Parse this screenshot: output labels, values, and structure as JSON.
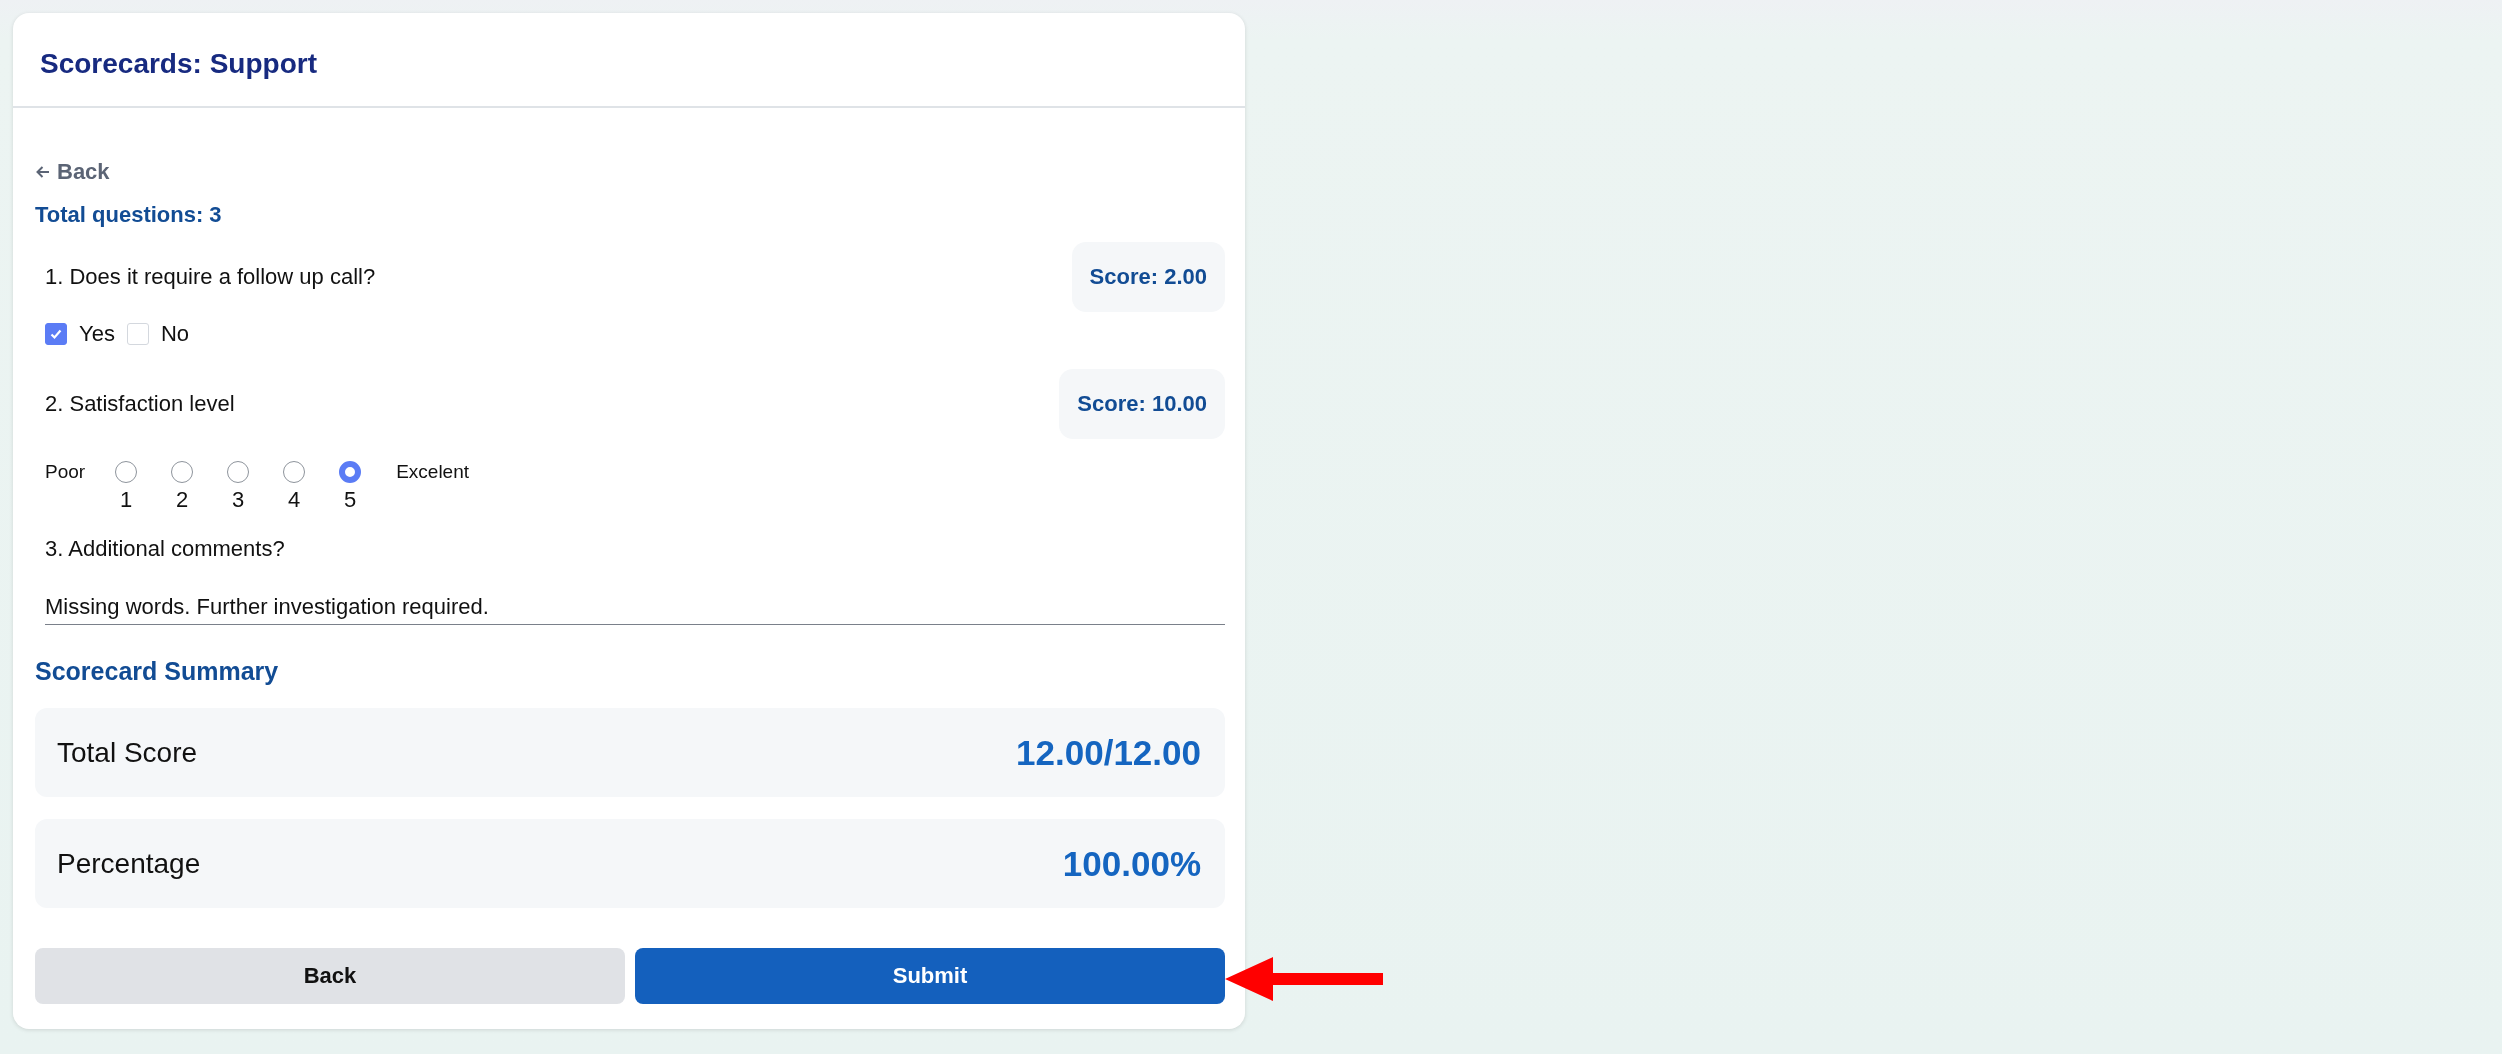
{
  "header": {
    "title": "Scorecards: Support"
  },
  "back_link": {
    "label": "Back"
  },
  "total_questions": "Total questions: 3",
  "questions": [
    {
      "kind": "checkbox",
      "text": "1. Does it require a follow up call?",
      "score": "Score: 2.00",
      "options": [
        {
          "label": "Yes",
          "checked": true
        },
        {
          "label": "No",
          "checked": false
        }
      ]
    },
    {
      "kind": "rating",
      "text": "2. Satisfaction level",
      "score": "Score: 10.00",
      "low_label": "Poor",
      "high_label": "Excelent",
      "options": [
        {
          "label": "1",
          "selected": false
        },
        {
          "label": "2",
          "selected": false
        },
        {
          "label": "3",
          "selected": false
        },
        {
          "label": "4",
          "selected": false
        },
        {
          "label": "5",
          "selected": true
        }
      ]
    },
    {
      "kind": "comment",
      "text": "3. Additional comments?",
      "value": "Missing words. Further investigation required."
    }
  ],
  "summary": {
    "title": "Scorecard Summary",
    "rows": [
      {
        "label": "Total Score",
        "value": "12.00/12.00"
      },
      {
        "label": "Percentage",
        "value": "100.00%"
      }
    ]
  },
  "buttons": [
    {
      "kind": "secondary",
      "label": "Back"
    },
    {
      "kind": "primary",
      "label": "Submit"
    }
  ]
}
